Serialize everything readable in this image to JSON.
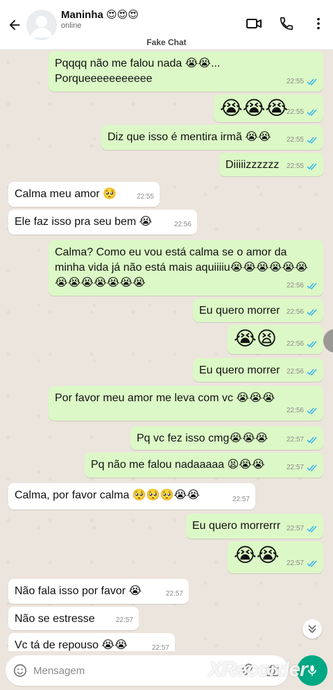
{
  "header": {
    "name": "Maninha 😍😍😍",
    "status": "online",
    "fake_label": "Fake Chat"
  },
  "messages": [
    {
      "dir": "out",
      "text": "Pqqqq não me falou nada 😭😭...\nPorqueeeeeeeeeee",
      "time": "22:55",
      "ticks": "read"
    },
    {
      "dir": "out",
      "text": "😭😭😭",
      "time": "22:55",
      "ticks": "read",
      "big": true
    },
    {
      "dir": "out",
      "text": "Diz que isso é mentira irmã 😭😭",
      "time": "22:55",
      "ticks": "read"
    },
    {
      "dir": "out",
      "text": "Diiiiizzzzzz",
      "time": "22:55",
      "ticks": "read"
    },
    {
      "dir": "in",
      "text": "Calma meu amor 🥺",
      "time": "22:55"
    },
    {
      "dir": "in",
      "text": "Ele faz isso pra seu bem 😭",
      "time": "22:56"
    },
    {
      "dir": "out",
      "text": "Calma? Como eu vou está calma se o amor da minha vida já não está mais aquiiiiu😭😭😭😭😭😭😭😭😭😭😭😭😭",
      "time": "22:56",
      "ticks": "read"
    },
    {
      "dir": "out",
      "text": "Eu quero morrer",
      "time": "22:56",
      "ticks": "read"
    },
    {
      "dir": "out",
      "text": "😭😫",
      "time": "22:56",
      "ticks": "read",
      "big": true
    },
    {
      "dir": "out",
      "text": "Eu quero morrer",
      "time": "22:56",
      "ticks": "read"
    },
    {
      "dir": "out",
      "text": "Por favor meu amor me leva com vc 😭😭😭",
      "time": "22:56",
      "ticks": "read"
    },
    {
      "dir": "out",
      "text": "Pq vc fez isso cmg😭😭😭",
      "time": "22:57",
      "ticks": "read"
    },
    {
      "dir": "out",
      "text": "Pq não me falou nadaaaaa 😫😭😭",
      "time": "22:57",
      "ticks": "read"
    },
    {
      "dir": "in",
      "text": "Calma, por favor calma 🥺🥺🥺😭😭",
      "time": "22:57"
    },
    {
      "dir": "out",
      "text": "Eu quero morrerrr",
      "time": "22:57",
      "ticks": "read"
    },
    {
      "dir": "out",
      "text": "😭😭",
      "time": "22:57",
      "ticks": "read",
      "big": true
    },
    {
      "dir": "in",
      "text": "Não fala isso por favor 😭",
      "time": "22:57"
    },
    {
      "dir": "in",
      "text": "Não se estresse",
      "time": "22:57"
    },
    {
      "dir": "in",
      "text": "Vc tá de repouso 😭😭",
      "time": "22:57"
    }
  ],
  "input": {
    "placeholder": "Mensagem"
  },
  "watermark": "XRecorder",
  "colors": {
    "outgoing_bubble": "#dcf8c6",
    "incoming_bubble": "#ffffff",
    "read_ticks": "#34b7f1",
    "send_button": "#00a884",
    "chat_bg": "#ece5dd"
  },
  "icons": {
    "back": "arrow-left-icon",
    "video": "video-camera-icon",
    "call": "phone-icon",
    "menu": "more-vertical-icon",
    "emoji": "emoji-icon",
    "attach": "attach-icon",
    "camera": "camera-icon",
    "mic": "mic-icon",
    "scroll": "chevron-double-down-icon"
  }
}
